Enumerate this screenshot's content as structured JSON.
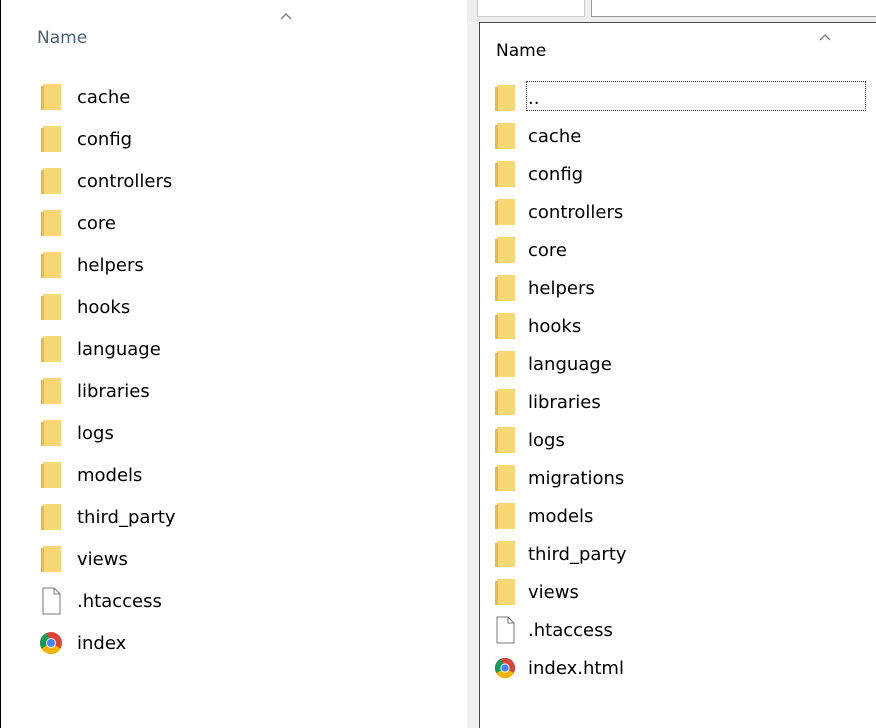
{
  "left_pane": {
    "column_header": "Name",
    "items": [
      {
        "name": "cache",
        "icon": "folder-icon"
      },
      {
        "name": "config",
        "icon": "folder-icon"
      },
      {
        "name": "controllers",
        "icon": "folder-icon"
      },
      {
        "name": "core",
        "icon": "folder-icon"
      },
      {
        "name": "helpers",
        "icon": "folder-icon"
      },
      {
        "name": "hooks",
        "icon": "folder-icon"
      },
      {
        "name": "language",
        "icon": "folder-icon"
      },
      {
        "name": "libraries",
        "icon": "folder-icon"
      },
      {
        "name": "logs",
        "icon": "folder-icon"
      },
      {
        "name": "models",
        "icon": "folder-icon"
      },
      {
        "name": "third_party",
        "icon": "folder-icon"
      },
      {
        "name": "views",
        "icon": "folder-icon"
      },
      {
        "name": ".htaccess",
        "icon": "file-icon"
      },
      {
        "name": "index",
        "icon": "chrome-icon"
      }
    ]
  },
  "right_pane": {
    "column_header": "Name",
    "items": [
      {
        "name": "..",
        "icon": "folder-icon"
      },
      {
        "name": "cache",
        "icon": "folder-icon"
      },
      {
        "name": "config",
        "icon": "folder-icon"
      },
      {
        "name": "controllers",
        "icon": "folder-icon"
      },
      {
        "name": "core",
        "icon": "folder-icon"
      },
      {
        "name": "helpers",
        "icon": "folder-icon"
      },
      {
        "name": "hooks",
        "icon": "folder-icon"
      },
      {
        "name": "language",
        "icon": "folder-icon"
      },
      {
        "name": "libraries",
        "icon": "folder-icon"
      },
      {
        "name": "logs",
        "icon": "folder-icon"
      },
      {
        "name": "migrations",
        "icon": "folder-icon"
      },
      {
        "name": "models",
        "icon": "folder-icon"
      },
      {
        "name": "third_party",
        "icon": "folder-icon"
      },
      {
        "name": "views",
        "icon": "folder-icon"
      },
      {
        "name": ".htaccess",
        "icon": "file-icon"
      },
      {
        "name": "index.html",
        "icon": "chrome-icon"
      }
    ]
  },
  "colors": {
    "folder": "#f8d775",
    "folder_shade": "#e8b84a",
    "left_header_text": "#4c607a"
  }
}
